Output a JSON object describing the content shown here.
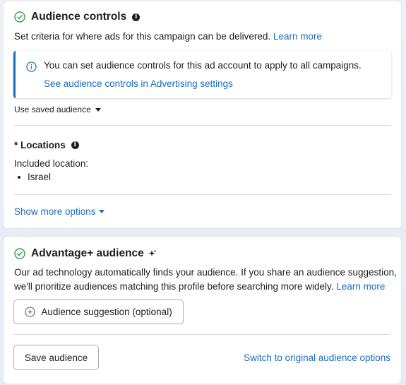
{
  "audience_controls": {
    "title": "Audience controls",
    "description": "Set criteria for where ads for this campaign can be delivered.",
    "learn_more": "Learn more",
    "notice": {
      "text": "You can set audience controls for this ad account to apply to all campaigns.",
      "link": "See audience controls in Advertising settings"
    },
    "saved_audience_dropdown": "Use saved audience",
    "locations": {
      "title": "* Locations",
      "included_label": "Included location:",
      "items": [
        "Israel"
      ]
    },
    "show_more": "Show more options"
  },
  "advantage_audience": {
    "title": "Advantage+ audience",
    "description_line1": "Our ad technology automatically finds your audience. If you share an audience suggestion,",
    "description_line2": "we'll prioritize audiences matching this profile before searching more widely.",
    "learn_more": "Learn more",
    "suggestion_button": "Audience suggestion (optional)",
    "save_button": "Save audience",
    "switch_link": "Switch to original audience options"
  },
  "colors": {
    "link": "#1a6dbb",
    "check_green": "#31a24c",
    "text": "#1c1e21"
  },
  "icons": [
    "check-circle-icon",
    "info-icon",
    "info-outline-icon",
    "caret-down-icon",
    "sparkle-icon",
    "plus-circle-icon"
  ]
}
